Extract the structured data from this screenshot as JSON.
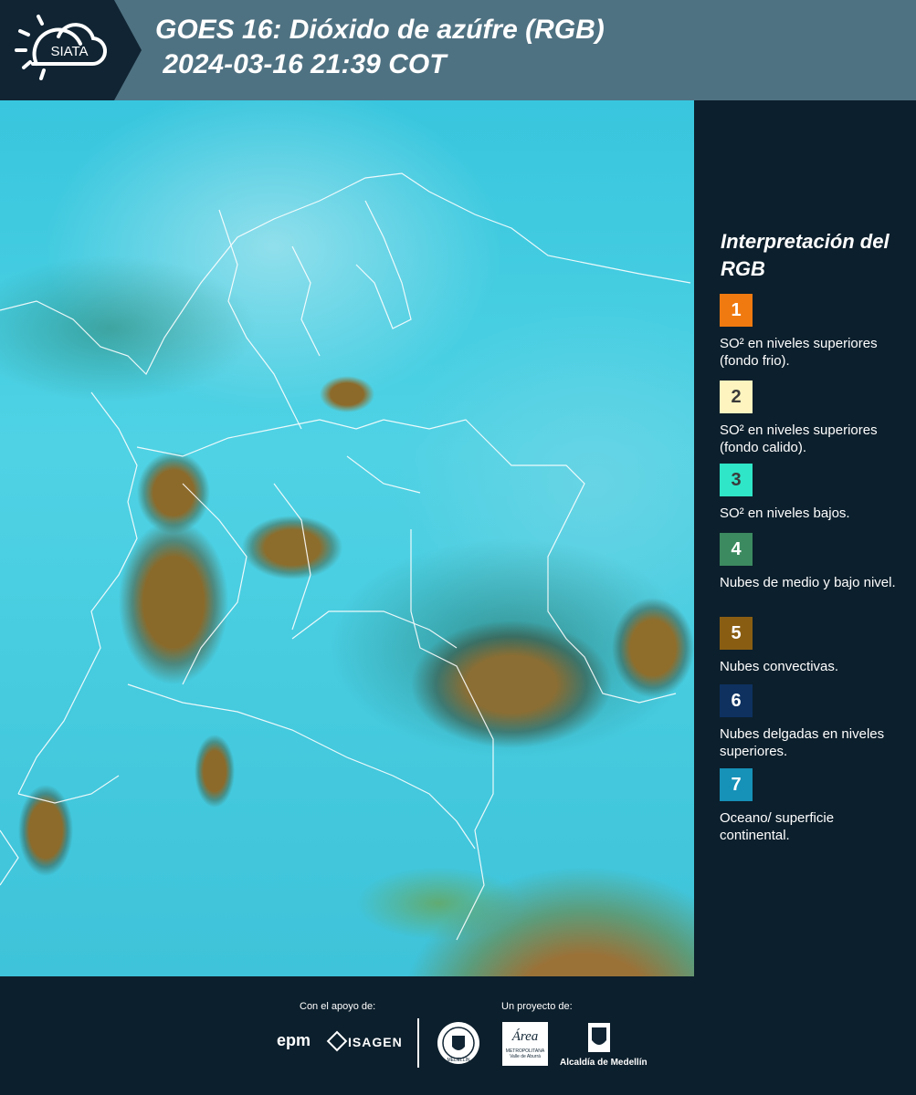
{
  "header": {
    "logo_text": "SIATA",
    "title_line1": "GOES 16: Dióxido de azúfre (RGB)",
    "title_line2": " 2024-03-16 21:39 COT",
    "bg_color": "#4f7282"
  },
  "map": {
    "icon": "satellite-image"
  },
  "legend": {
    "title": "Interpretación del RGB",
    "items": [
      {
        "number": "1",
        "color": "#f07a10",
        "text": "SO² en niveles superiores (fondo frio)."
      },
      {
        "number": "2",
        "color": "#fdf4bf",
        "text": "SO² en niveles superiores (fondo calido)."
      },
      {
        "number": "3",
        "color": "#2fe6c8",
        "text": "SO² en niveles bajos."
      },
      {
        "number": "4",
        "color": "#3c8a60",
        "text": "Nubes de medio y bajo nivel."
      },
      {
        "number": "5",
        "color": "#8a5e12",
        "text": "Nubes convectivas."
      },
      {
        "number": "6",
        "color": "#0e3160",
        "text": "Nubes delgadas en niveles superiores."
      },
      {
        "number": "7",
        "color": "#1691b8",
        "text": "Oceano/ superficie continental."
      }
    ]
  },
  "footer": {
    "support_label": "Con el apoyo de:",
    "project_label": "Un proyecto de:",
    "epm": "epm",
    "isagen": "ISAGEN",
    "area_metropolitana": "Área",
    "area_sub": "METROPOLITANA",
    "area_sub2": "Valle de Aburrá",
    "alcaldia": "Alcaldía de Medellín",
    "seal_text": "MEDELLÍN"
  }
}
